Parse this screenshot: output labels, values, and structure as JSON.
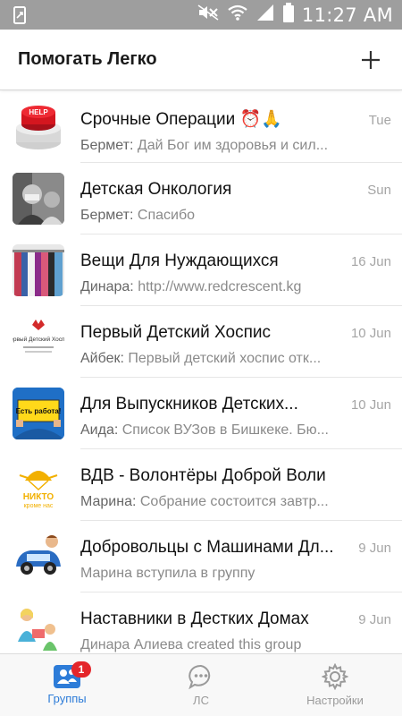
{
  "status_bar": {
    "time": "11:27 AM",
    "icons": [
      "notification-phone-icon",
      "mute-icon",
      "wifi-icon",
      "signal-icon",
      "battery-icon"
    ]
  },
  "app_bar": {
    "title": "Помогать Легко",
    "add_icon": "plus-icon"
  },
  "groups": [
    {
      "name": "Срочные Операции ⏰🙏",
      "date": "Tue",
      "sender": "Бермет:",
      "message": "Дай Бог им здоровья и сил..."
    },
    {
      "name": "Детская Онкология",
      "date": "Sun",
      "sender": "Бермет:",
      "message": "Спасибо"
    },
    {
      "name": "Вещи Для Нуждающихся",
      "date": "16 Jun",
      "sender": "Динара:",
      "message": "http://www.redcrescent.kg"
    },
    {
      "name": "Первый Детский Хоспис",
      "date": "10 Jun",
      "sender": "Айбек:",
      "message": "Первый детский хоспис отк..."
    },
    {
      "name": "Для Выпускников Детских...",
      "date": "10 Jun",
      "sender": "Аида:",
      "message": "Список ВУЗов в Бишкеке. Бю..."
    },
    {
      "name": "ВДВ - Волонтёры Доброй Воли",
      "date": "",
      "sender": "Марина:",
      "message": "Собрание состоится завтр..."
    },
    {
      "name": "Добровольцы с Машинами Дл...",
      "date": "9 Jun",
      "sender": "",
      "message": "Марина вступила в группу"
    },
    {
      "name": "Наставники в Дестких Домах",
      "date": "9 Jun",
      "sender": "",
      "message": "Динара Алиева created this group"
    }
  ],
  "avatars": {
    "help_label": "HELP",
    "hospice_title": "Первый Детский Хоспис",
    "sign_text": "Есть работа!",
    "vdv_text1": "НИКТО",
    "vdv_text2": "кроме нас"
  },
  "bottom_nav": {
    "tabs": [
      {
        "label": "Группы",
        "icon": "groups-icon",
        "badge": "1"
      },
      {
        "label": "ЛС",
        "icon": "chat-bubble-icon"
      },
      {
        "label": "Настройки",
        "icon": "gear-icon"
      }
    ]
  },
  "colors": {
    "accent": "#2d7cd8",
    "badge": "#e4262b",
    "status_bar": "#9e9e9e"
  }
}
